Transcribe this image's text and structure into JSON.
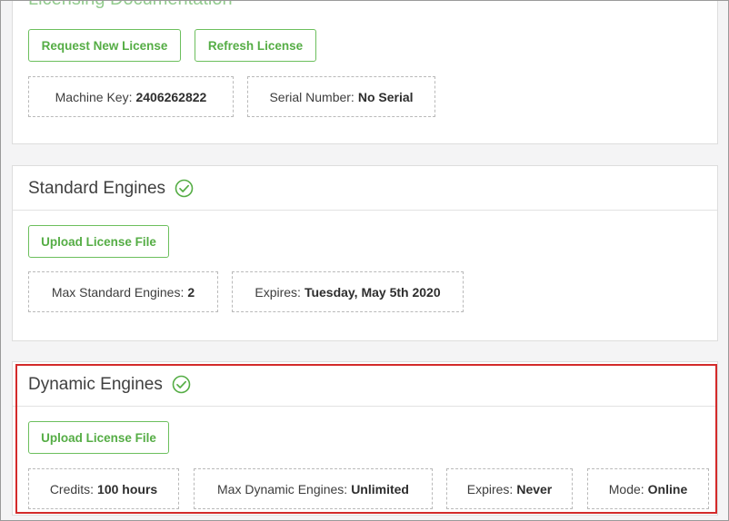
{
  "top_section": {
    "cutoff_heading": "Licensing Documentation",
    "request_button": "Request New License",
    "refresh_button": "Refresh License",
    "machine_key": {
      "label": "Machine Key:",
      "value": "2406262822"
    },
    "serial_number": {
      "label": "Serial Number:",
      "value": "No Serial"
    }
  },
  "standard_engines": {
    "title": "Standard Engines",
    "status_icon": "check-circle-icon",
    "upload_button": "Upload License File",
    "max_engines": {
      "label": "Max Standard Engines:",
      "value": "2"
    },
    "expires": {
      "label": "Expires:",
      "value": "Tuesday, May 5th 2020"
    }
  },
  "dynamic_engines": {
    "title": "Dynamic Engines",
    "status_icon": "check-circle-icon",
    "upload_button": "Upload License File",
    "credits": {
      "label": "Credits:",
      "value": "100 hours"
    },
    "max_engines": {
      "label": "Max Dynamic Engines:",
      "value": "Unlimited"
    },
    "expires": {
      "label": "Expires:",
      "value": "Never"
    },
    "mode": {
      "label": "Mode:",
      "value": "Online"
    }
  },
  "colors": {
    "accent_green": "#55ad45",
    "highlight_red": "#d32a2a"
  }
}
